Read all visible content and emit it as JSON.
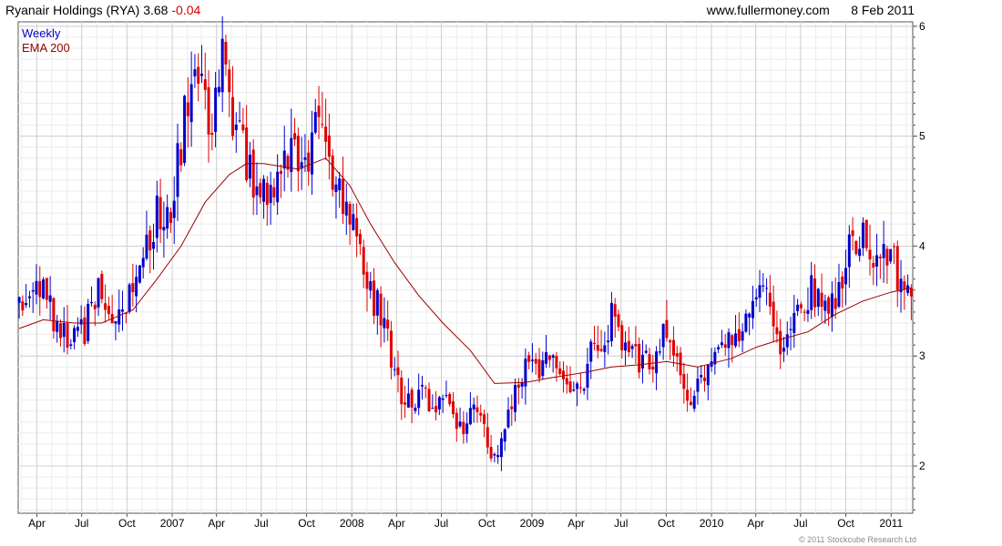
{
  "header": {
    "title": "Ryanair Holdings (RYA)",
    "last": "3.68",
    "change": "-0.04",
    "site": "www.fullermoney.com",
    "date": "8 Feb 2011"
  },
  "copyright": "© 2011 Stockcube Research Ltd",
  "colors": {
    "up": "#0000cc",
    "down": "#e00000",
    "ema": "#990000",
    "grid": "#d0d0d0",
    "axis": "#555555"
  },
  "chart_data": {
    "type": "candlestick",
    "interval": "Weekly",
    "legend": [
      {
        "label": "Weekly",
        "color": "#0000cc"
      },
      {
        "label": "EMA 200",
        "color": "#990000"
      }
    ],
    "legend_position": "top-left",
    "grid": true,
    "y_axis_position": "right",
    "ylim": [
      1.57,
      6.04
    ],
    "yticks": [
      2,
      3,
      4,
      5,
      6
    ],
    "xlim": [
      "2006-02-22",
      "2011-02-14"
    ],
    "xticks": [
      {
        "date": "2006-04-01",
        "label": "Apr"
      },
      {
        "date": "2006-07-01",
        "label": "Jul"
      },
      {
        "date": "2006-10-01",
        "label": "Oct"
      },
      {
        "date": "2007-01-01",
        "label": "2007"
      },
      {
        "date": "2007-04-01",
        "label": "Apr"
      },
      {
        "date": "2007-07-01",
        "label": "Jul"
      },
      {
        "date": "2007-10-01",
        "label": "Oct"
      },
      {
        "date": "2008-01-01",
        "label": "2008"
      },
      {
        "date": "2008-04-01",
        "label": "Apr"
      },
      {
        "date": "2008-07-01",
        "label": "Jul"
      },
      {
        "date": "2008-10-01",
        "label": "Oct"
      },
      {
        "date": "2009-01-01",
        "label": "2009"
      },
      {
        "date": "2009-04-01",
        "label": "Apr"
      },
      {
        "date": "2009-07-01",
        "label": "Jul"
      },
      {
        "date": "2009-10-01",
        "label": "Oct"
      },
      {
        "date": "2010-01-01",
        "label": "2010"
      },
      {
        "date": "2010-04-01",
        "label": "Apr"
      },
      {
        "date": "2010-07-01",
        "label": "Jul"
      },
      {
        "date": "2010-10-01",
        "label": "Oct"
      },
      {
        "date": "2011-01-01",
        "label": "2011"
      }
    ],
    "price_path": [
      [
        "2006-02-24",
        3.52
      ],
      [
        "2006-03-17",
        3.6
      ],
      [
        "2006-04-14",
        3.55
      ],
      [
        "2006-05-12",
        3.28
      ],
      [
        "2006-06-09",
        3.12
      ],
      [
        "2006-07-07",
        3.25
      ],
      [
        "2006-08-04",
        3.55
      ],
      [
        "2006-09-01",
        3.35
      ],
      [
        "2006-10-06",
        3.55
      ],
      [
        "2006-11-03",
        3.9
      ],
      [
        "2006-12-01",
        4.3
      ],
      [
        "2006-12-29",
        4.4
      ],
      [
        "2007-01-19",
        4.95
      ],
      [
        "2007-02-09",
        5.55
      ],
      [
        "2007-02-23",
        5.7
      ],
      [
        "2007-03-16",
        5.0
      ],
      [
        "2007-04-06",
        5.55
      ],
      [
        "2007-04-20",
        5.75
      ],
      [
        "2007-05-04",
        5.15
      ],
      [
        "2007-05-25",
        4.85
      ],
      [
        "2007-06-15",
        4.6
      ],
      [
        "2007-07-06",
        4.6
      ],
      [
        "2007-07-27",
        4.45
      ],
      [
        "2007-08-17",
        4.75
      ],
      [
        "2007-09-07",
        4.85
      ],
      [
        "2007-09-28",
        4.6
      ],
      [
        "2007-10-19",
        5.05
      ],
      [
        "2007-11-02",
        5.25
      ],
      [
        "2007-11-16",
        4.8
      ],
      [
        "2007-12-07",
        4.55
      ],
      [
        "2007-12-28",
        4.3
      ],
      [
        "2008-01-18",
        3.85
      ],
      [
        "2008-02-08",
        3.55
      ],
      [
        "2008-02-29",
        3.4
      ],
      [
        "2008-03-21",
        3.0
      ],
      [
        "2008-04-11",
        2.65
      ],
      [
        "2008-05-02",
        2.6
      ],
      [
        "2008-05-23",
        2.7
      ],
      [
        "2008-06-13",
        2.45
      ],
      [
        "2008-07-04",
        2.7
      ],
      [
        "2008-07-25",
        2.45
      ],
      [
        "2008-08-15",
        2.35
      ],
      [
        "2008-09-05",
        2.55
      ],
      [
        "2008-09-26",
        2.3
      ],
      [
        "2008-10-17",
        2.05
      ],
      [
        "2008-11-07",
        2.35
      ],
      [
        "2008-11-28",
        2.75
      ],
      [
        "2008-12-19",
        2.9
      ],
      [
        "2009-01-16",
        2.85
      ],
      [
        "2009-02-06",
        2.95
      ],
      [
        "2009-02-27",
        2.75
      ],
      [
        "2009-03-20",
        2.65
      ],
      [
        "2009-04-10",
        2.7
      ],
      [
        "2009-05-01",
        3.0
      ],
      [
        "2009-05-22",
        3.1
      ],
      [
        "2009-06-12",
        3.35
      ],
      [
        "2009-07-03",
        3.05
      ],
      [
        "2009-07-24",
        3.0
      ],
      [
        "2009-08-14",
        2.95
      ],
      [
        "2009-09-04",
        2.9
      ],
      [
        "2009-09-25",
        3.15
      ],
      [
        "2009-10-16",
        3.05
      ],
      [
        "2009-11-06",
        2.7
      ],
      [
        "2009-11-27",
        2.65
      ],
      [
        "2009-12-18",
        2.9
      ],
      [
        "2010-01-15",
        3.15
      ],
      [
        "2010-02-05",
        3.15
      ],
      [
        "2010-02-26",
        3.2
      ],
      [
        "2010-03-19",
        3.3
      ],
      [
        "2010-04-09",
        3.6
      ],
      [
        "2010-04-30",
        3.5
      ],
      [
        "2010-05-21",
        3.0
      ],
      [
        "2010-06-11",
        3.3
      ],
      [
        "2010-07-02",
        3.5
      ],
      [
        "2010-07-23",
        3.6
      ],
      [
        "2010-08-13",
        3.55
      ],
      [
        "2010-09-03",
        3.5
      ],
      [
        "2010-09-24",
        3.75
      ],
      [
        "2010-10-15",
        4.05
      ],
      [
        "2010-11-05",
        4.1
      ],
      [
        "2010-11-26",
        3.8
      ],
      [
        "2010-12-17",
        3.85
      ],
      [
        "2011-01-07",
        3.9
      ],
      [
        "2011-01-21",
        3.55
      ],
      [
        "2011-02-04",
        3.72
      ],
      [
        "2011-02-11",
        3.68
      ]
    ],
    "ema_200": [
      [
        "2006-02-24",
        3.25
      ],
      [
        "2006-04-14",
        3.33
      ],
      [
        "2006-06-16",
        3.3
      ],
      [
        "2006-08-11",
        3.3
      ],
      [
        "2006-10-13",
        3.42
      ],
      [
        "2006-12-01",
        3.7
      ],
      [
        "2007-01-19",
        4.0
      ],
      [
        "2007-03-09",
        4.4
      ],
      [
        "2007-04-27",
        4.65
      ],
      [
        "2007-06-01",
        4.75
      ],
      [
        "2007-07-06",
        4.75
      ],
      [
        "2007-09-14",
        4.7
      ],
      [
        "2007-11-09",
        4.8
      ],
      [
        "2007-12-28",
        4.55
      ],
      [
        "2008-02-08",
        4.2
      ],
      [
        "2008-03-28",
        3.85
      ],
      [
        "2008-05-16",
        3.55
      ],
      [
        "2008-07-04",
        3.3
      ],
      [
        "2008-08-29",
        3.05
      ],
      [
        "2008-10-17",
        2.75
      ],
      [
        "2008-12-19",
        2.76
      ],
      [
        "2009-02-06",
        2.8
      ],
      [
        "2009-04-17",
        2.85
      ],
      [
        "2009-06-12",
        2.9
      ],
      [
        "2009-08-07",
        2.92
      ],
      [
        "2009-10-02",
        2.95
      ],
      [
        "2009-12-04",
        2.9
      ],
      [
        "2010-02-12",
        2.98
      ],
      [
        "2010-04-02",
        3.08
      ],
      [
        "2010-05-21",
        3.15
      ],
      [
        "2010-07-16",
        3.22
      ],
      [
        "2010-09-10",
        3.38
      ],
      [
        "2010-11-05",
        3.5
      ],
      [
        "2010-12-31",
        3.58
      ],
      [
        "2011-02-11",
        3.62
      ]
    ]
  }
}
